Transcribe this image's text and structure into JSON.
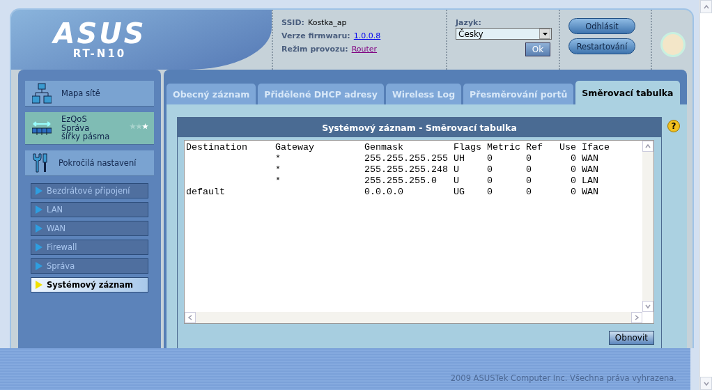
{
  "header": {
    "logo": "ASUS",
    "model": "RT-N10",
    "info": [
      {
        "label": "SSID:",
        "value": "Kostka_ap",
        "kind": "text"
      },
      {
        "label": "Verze firmwaru:",
        "value": "1.0.0.8",
        "kind": "link"
      },
      {
        "label": "Režim provozu:",
        "value": "Router",
        "kind": "visited"
      }
    ],
    "language": {
      "label": "Jazyk:",
      "value": "Česky",
      "ok": "Ok"
    },
    "buttons": [
      "Odhlásit",
      "Restartování"
    ]
  },
  "sidebar": {
    "items": [
      {
        "label": "Mapa sítě",
        "kind": "map",
        "selected": false
      },
      {
        "label": "EzQoS\nSpráva\nšířky pásma",
        "kind": "qos",
        "stars": 1,
        "selected": true
      },
      {
        "label": "Pokročilá nastavení",
        "kind": "tools",
        "selected": false
      }
    ],
    "submenu": [
      {
        "label": "Bezdrátové připojení",
        "selected": false
      },
      {
        "label": "LAN",
        "selected": false
      },
      {
        "label": "WAN",
        "selected": false
      },
      {
        "label": "Firewall",
        "selected": false
      },
      {
        "label": "Správa",
        "selected": false
      },
      {
        "label": "Systémový záznam",
        "selected": true
      }
    ]
  },
  "tabs": [
    {
      "label": "Obecný záznam",
      "selected": false
    },
    {
      "label": "Přidělené DHCP adresy",
      "selected": false
    },
    {
      "label": "Wireless Log",
      "selected": false
    },
    {
      "label": "Přesměrování portů",
      "selected": false
    },
    {
      "label": "Směrovací tabulka",
      "selected": true
    }
  ],
  "help": "?",
  "panel": {
    "title": "Systémový záznam - Směrovací tabulka",
    "columns": [
      "Destination",
      "Gateway",
      "Genmask",
      "Flags",
      "Metric",
      "Ref",
      "Use",
      "Iface"
    ],
    "rows": [
      {
        "gateway": "*",
        "genmask": "255.255.255.255",
        "flags": "UH",
        "metric": "0",
        "ref": "0",
        "use": "0",
        "iface": "WAN"
      },
      {
        "gateway": "*",
        "genmask": "255.255.255.248",
        "flags": "U",
        "metric": "0",
        "ref": "0",
        "use": "0",
        "iface": "WAN"
      },
      {
        "gateway": "*",
        "genmask": "255.255.255.0",
        "flags": "U",
        "metric": "0",
        "ref": "0",
        "use": "0",
        "iface": "LAN"
      },
      {
        "destination": "default",
        "genmask": "0.0.0.0",
        "flags": "UG",
        "metric": "0",
        "ref": "0",
        "use": "0",
        "iface": "WAN"
      }
    ],
    "button": "Obnovit"
  },
  "footer": "2009 ASUSTek Computer Inc. Všechna práva vyhrazena."
}
